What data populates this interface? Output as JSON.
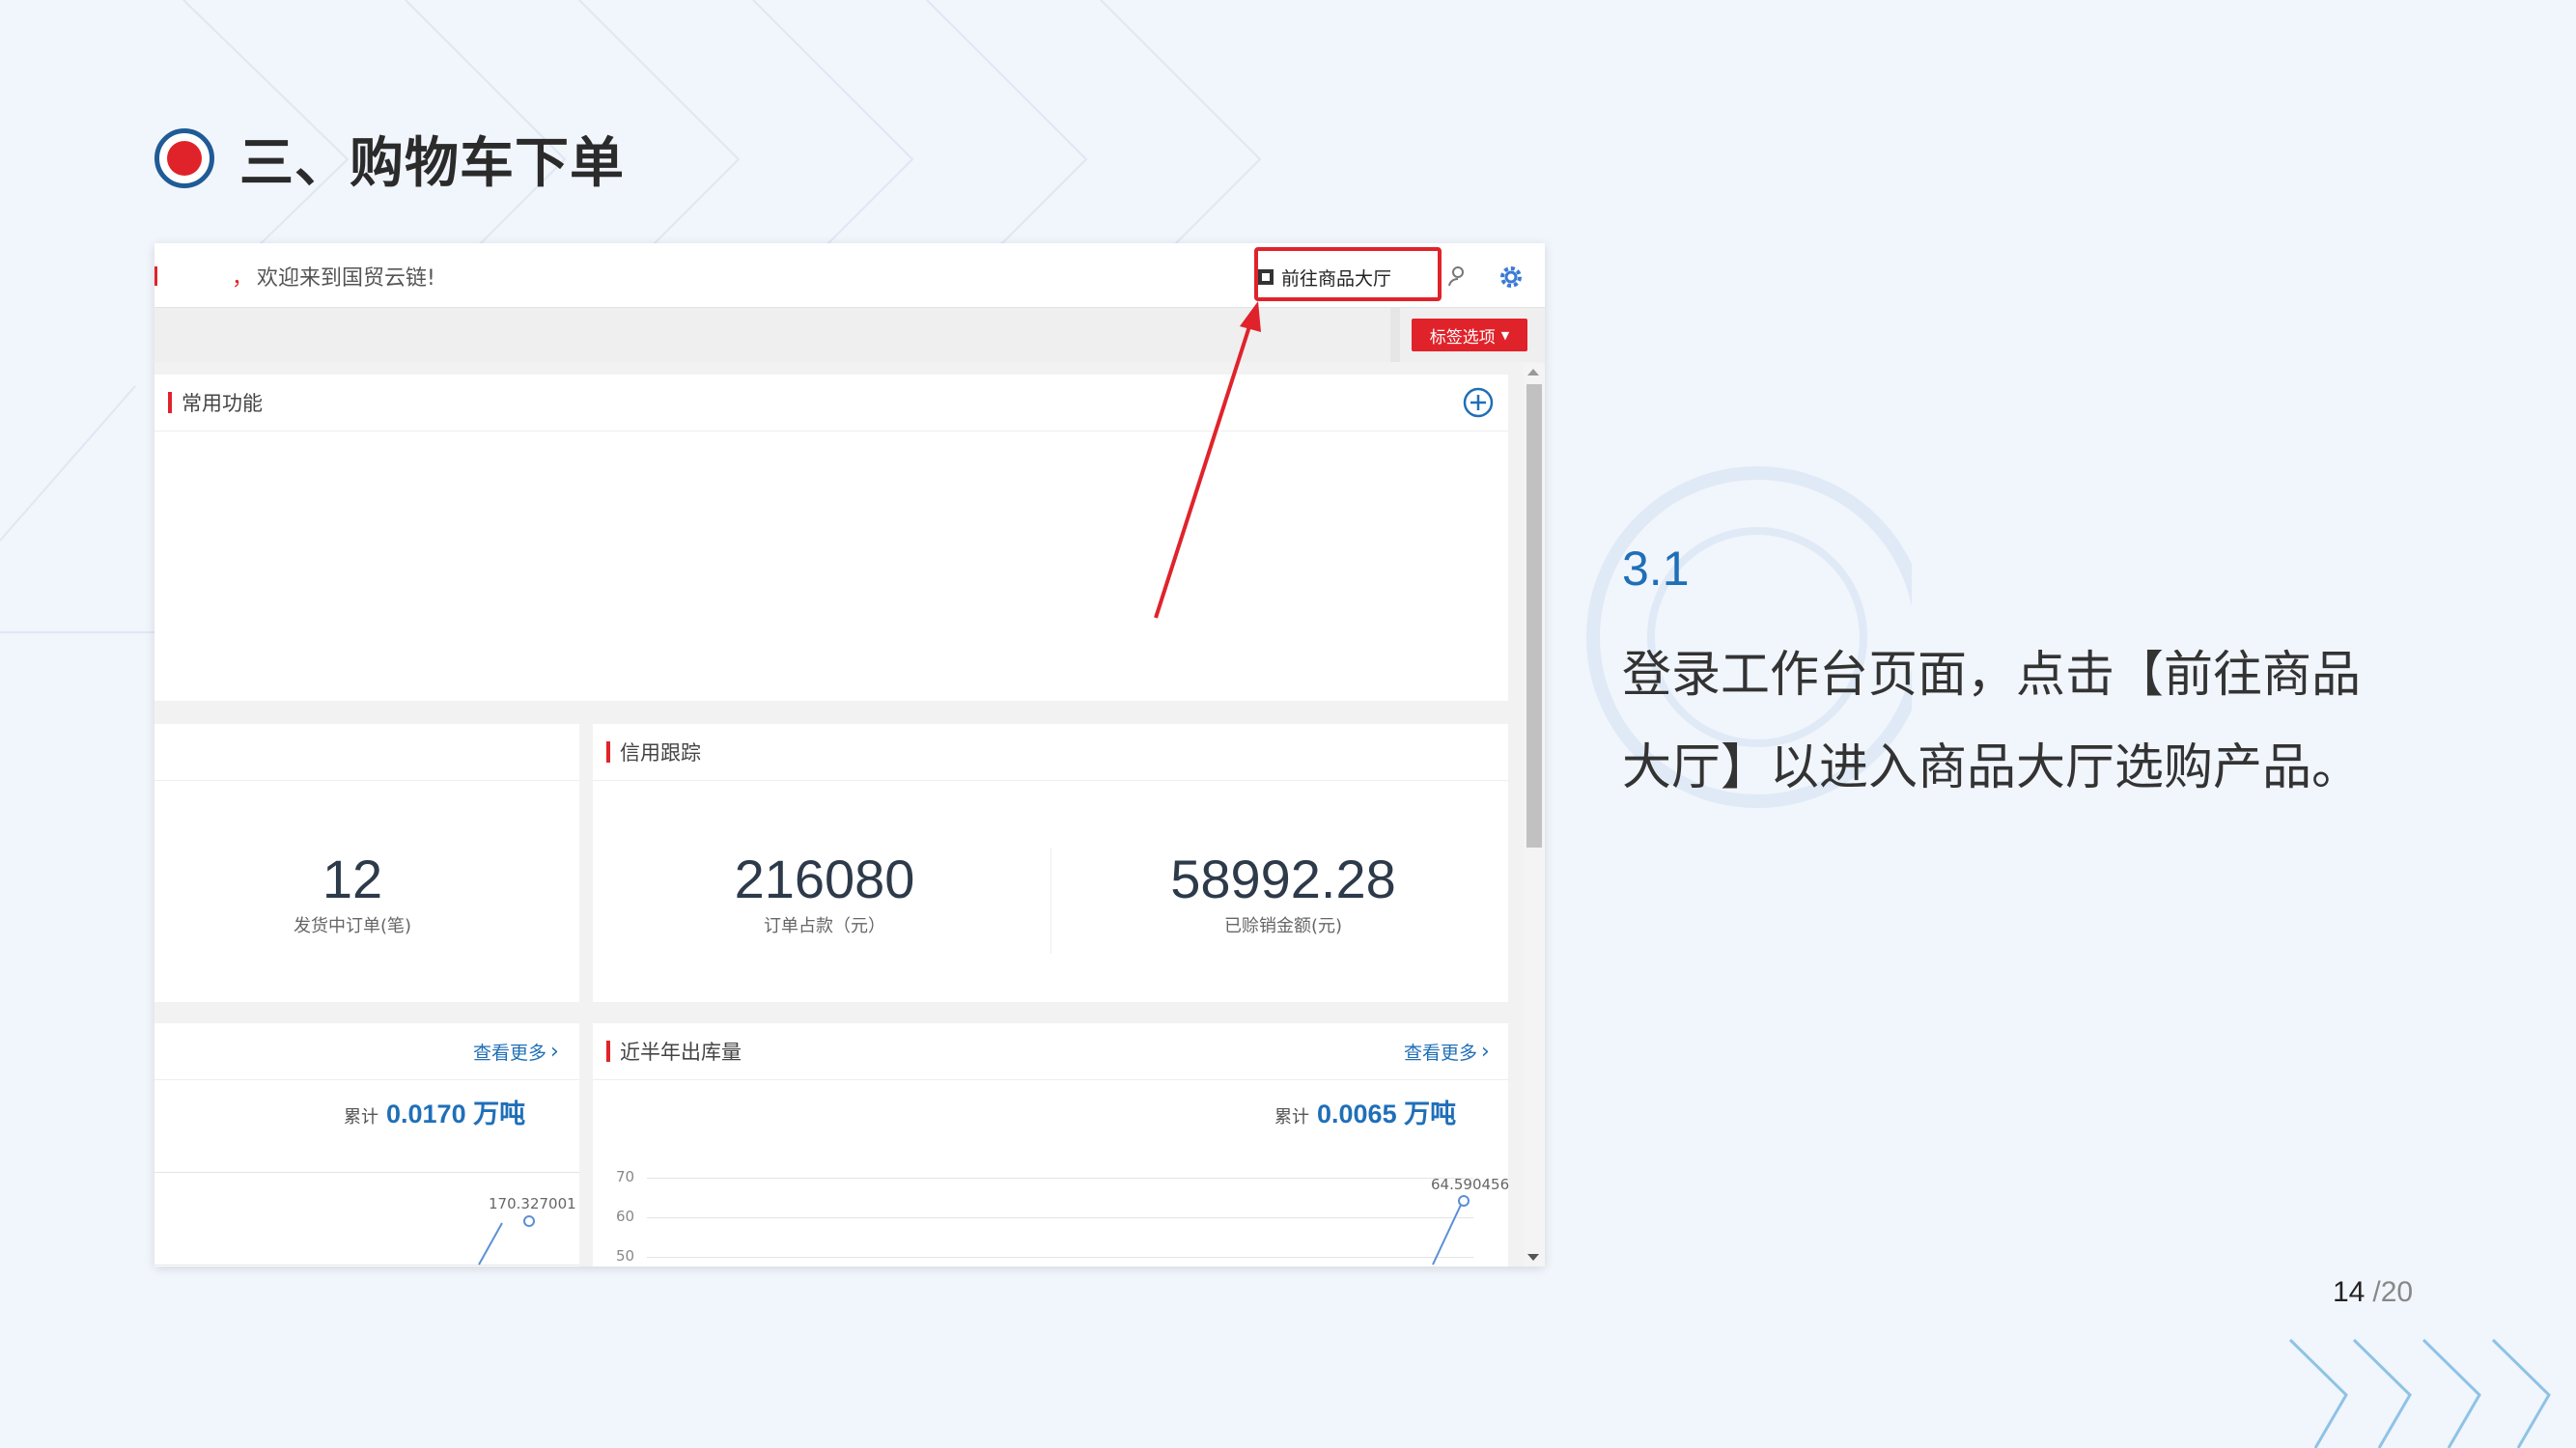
{
  "slide": {
    "title": "三、购物车下单",
    "step_number": "3.1",
    "step_description": "登录工作台页面，点击【前往商品大厅】以进入商品大厅选购产品。",
    "page_current": "14",
    "page_total": "/20"
  },
  "app": {
    "welcome_comma": "，",
    "welcome_text": "欢迎来到国贸云链!",
    "goto_button": "前往商品大厅",
    "tag_button": "标签选项"
  },
  "cards": {
    "common_functions": "常用功能",
    "credit_tracking": "信用跟踪",
    "outbound_half_year": "近半年出库量"
  },
  "kpis": {
    "shipping_orders_value": "12",
    "shipping_orders_label": "发货中订单(笔)",
    "order_occupied_value": "216080",
    "order_occupied_label": "订单占款（元）",
    "credit_sales_value": "58992.28",
    "credit_sales_label": "已赊销金额(元)"
  },
  "left_chart": {
    "more_label": "查看更多",
    "cumulative_label": "累计",
    "cumulative_value": "0.0170 万吨",
    "point_label": "170.327001"
  },
  "right_chart": {
    "more_label": "查看更多",
    "cumulative_label": "累计",
    "cumulative_value": "0.0065 万吨",
    "point_label": "64.590456",
    "y_ticks": [
      "70",
      "60",
      "50"
    ]
  },
  "colors": {
    "accent_red": "#e0232b",
    "link_blue": "#1f6fb8",
    "title_ring": "#1f5b96"
  }
}
